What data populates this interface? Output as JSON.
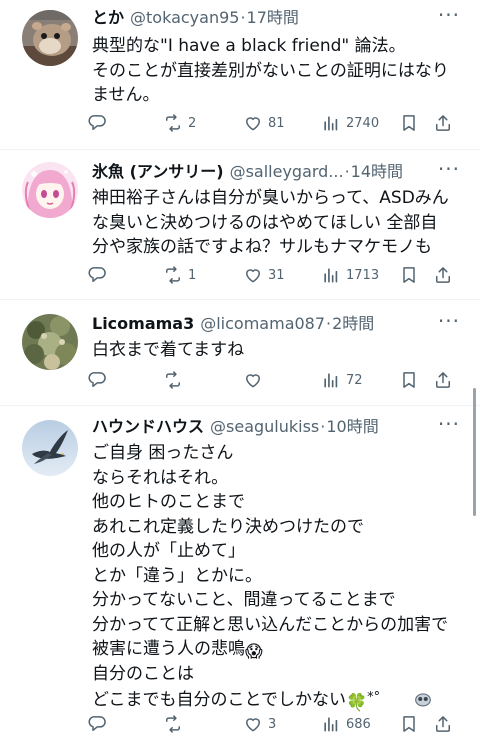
{
  "tweets": [
    {
      "display_name": "とか",
      "handle": "@tokacyan95",
      "separator": "·",
      "time": "17時間",
      "lines": [
        "典型的な\"I have a black  friend\"    論法。",
        "そのことが直接差別がないことの証明にはなり",
        "ません。"
      ],
      "retweets": "2",
      "likes": "81",
      "views": "2740",
      "avatar_icon": "hamster-avatar"
    },
    {
      "display_name": "氷魚 (アンサリー)",
      "handle": "@salleygard...",
      "separator": "·",
      "time": "14時間",
      "lines": [
        "神田裕子さんは自分が臭いからって、ASDみん",
        "な臭いと決めつけるのはやめてほしい  全部自",
        "分や家族の話ですよね？サルもナマケモノも"
      ],
      "retweets": "1",
      "likes": "31",
      "views": "1713",
      "avatar_icon": "anime-girl-avatar"
    },
    {
      "display_name": "Licomama3",
      "handle": "@licomama087",
      "separator": "·",
      "time": "2時間",
      "lines": [
        "白衣まで着てますね"
      ],
      "retweets": "",
      "likes": "",
      "views": "72",
      "avatar_icon": "plant-avatar"
    },
    {
      "display_name": "ハウンドハウス",
      "handle": "@seagulukiss",
      "separator": "·",
      "time": "10時間",
      "lines": [
        "ご自身 困ったさん",
        "ならそれはそれ。",
        "他のヒトのことまで",
        "あれこれ定義したり決めつけたので",
        "他の人が「止めて」",
        "とか「違う」とかに。",
        "分かってないこと、間違ってることまで",
        "分かってて正解と思い込んだことからの加害で",
        "被害に遭う人の悲鳴",
        "自分のことは",
        "どこまでも自分のことでしかない"
      ],
      "line_emoji_scream": "😱",
      "line_emoji_clover": "🍀",
      "line_emoji_tail": "*°",
      "retweets": "",
      "likes": "3",
      "views": "686",
      "avatar_icon": "seagull-avatar"
    }
  ],
  "icons": {
    "reply": "reply-icon",
    "retweet": "retweet-icon",
    "like": "heart-icon",
    "views": "views-icon",
    "bookmark": "bookmark-icon",
    "share": "share-icon",
    "more": "more-icon",
    "translate": "translate-icon"
  },
  "more_glyph": "···",
  "colors": {
    "text": "#0f1419",
    "secondary": "#536471",
    "divider": "#eff3f4"
  }
}
